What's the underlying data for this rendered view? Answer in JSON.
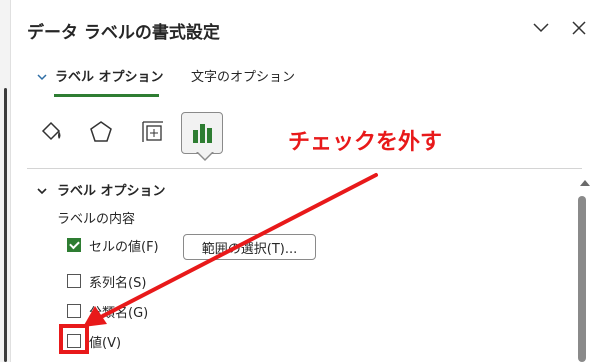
{
  "pane": {
    "title": "データ ラベルの書式設定",
    "collapse_icon": "chevron-down-icon",
    "close_icon": "close-icon"
  },
  "tabs": [
    {
      "label": "ラベル オプション",
      "active": true
    },
    {
      "label": "文字のオプション",
      "active": false
    }
  ],
  "icon_toolbar": [
    {
      "name": "fill-line-icon",
      "selected": false
    },
    {
      "name": "effects-icon",
      "selected": false
    },
    {
      "name": "size-properties-icon",
      "selected": false
    },
    {
      "name": "label-options-icon",
      "selected": true
    }
  ],
  "section": {
    "header": "ラベル オプション",
    "sub_label": "ラベルの内容",
    "options": [
      {
        "label": "セルの値(F)",
        "checked": true
      },
      {
        "label": "系列名(S)",
        "checked": false
      },
      {
        "label": "分類名(G)",
        "checked": false
      },
      {
        "label": "値(V)",
        "checked": false
      }
    ],
    "range_button": "範囲の選択(T)..."
  },
  "annotation": {
    "text": "チェックを外す",
    "color": "#e8191a"
  },
  "colors": {
    "accent_green": "#2e7d32",
    "annotation_red": "#e8191a"
  }
}
